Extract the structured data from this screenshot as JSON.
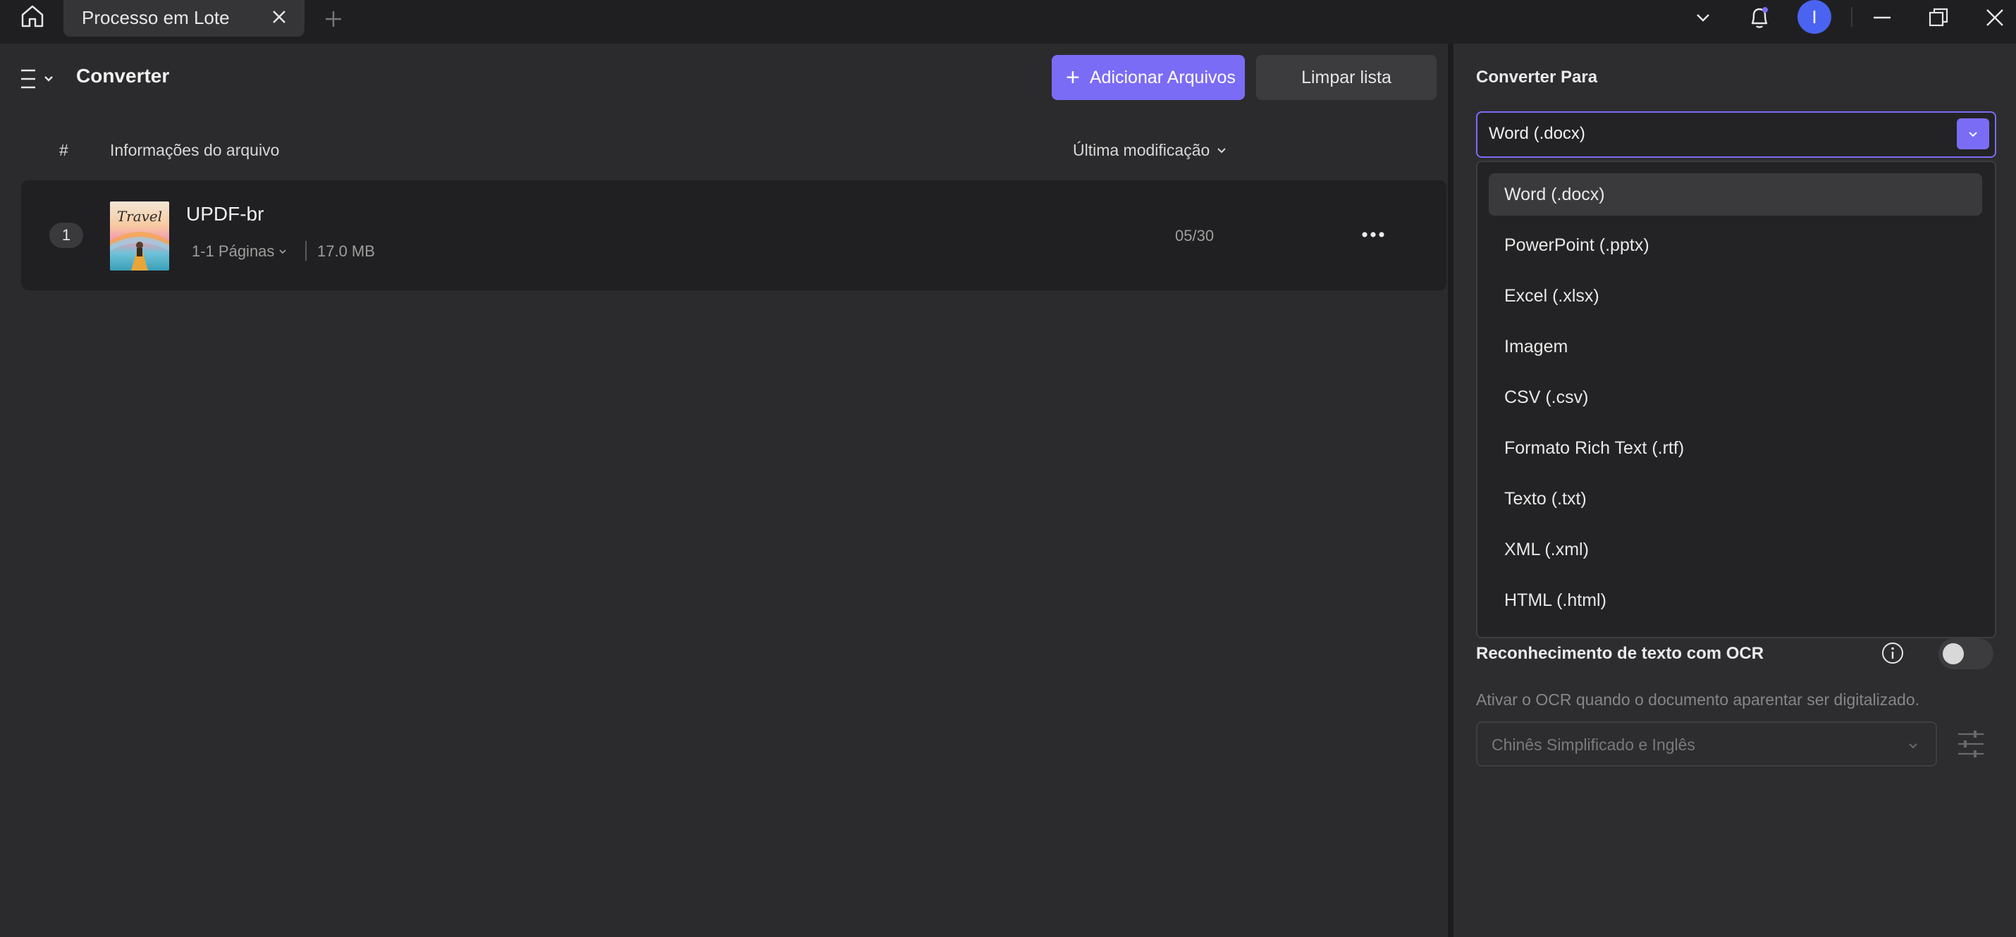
{
  "titlebar": {
    "tab_label": "Processo em Lote",
    "avatar_letter": "I"
  },
  "toolbar": {
    "section_title": "Converter",
    "add_files_label": "Adicionar Arquivos",
    "clear_list_label": "Limpar lista"
  },
  "table": {
    "col_index": "#",
    "col_info": "Informações do arquivo",
    "col_modified": "Última modificação",
    "rows": [
      {
        "index": "1",
        "thumbnail_text": "Travel",
        "name": "UPDF-br",
        "pages": "1-1 Páginas",
        "size": "17.0 MB",
        "modified": "05/30"
      }
    ]
  },
  "convert": {
    "label": "Converter Para",
    "selected": "Word (.docx)",
    "options": [
      "Word (.docx)",
      "PowerPoint (.pptx)",
      "Excel (.xlsx)",
      "Imagem",
      "CSV (.csv)",
      "Formato Rich Text (.rtf)",
      "Texto (.txt)",
      "XML (.xml)",
      "HTML (.html)"
    ]
  },
  "ocr": {
    "label": "Reconhecimento de texto com OCR",
    "enabled": false,
    "description": "Ativar o OCR quando o documento aparentar ser digitalizado.",
    "language": "Chinês Simplificado e Inglês"
  },
  "colors": {
    "accent": "#7b6cf6",
    "avatar": "#4a63f0",
    "background": "#2b2b2d"
  }
}
